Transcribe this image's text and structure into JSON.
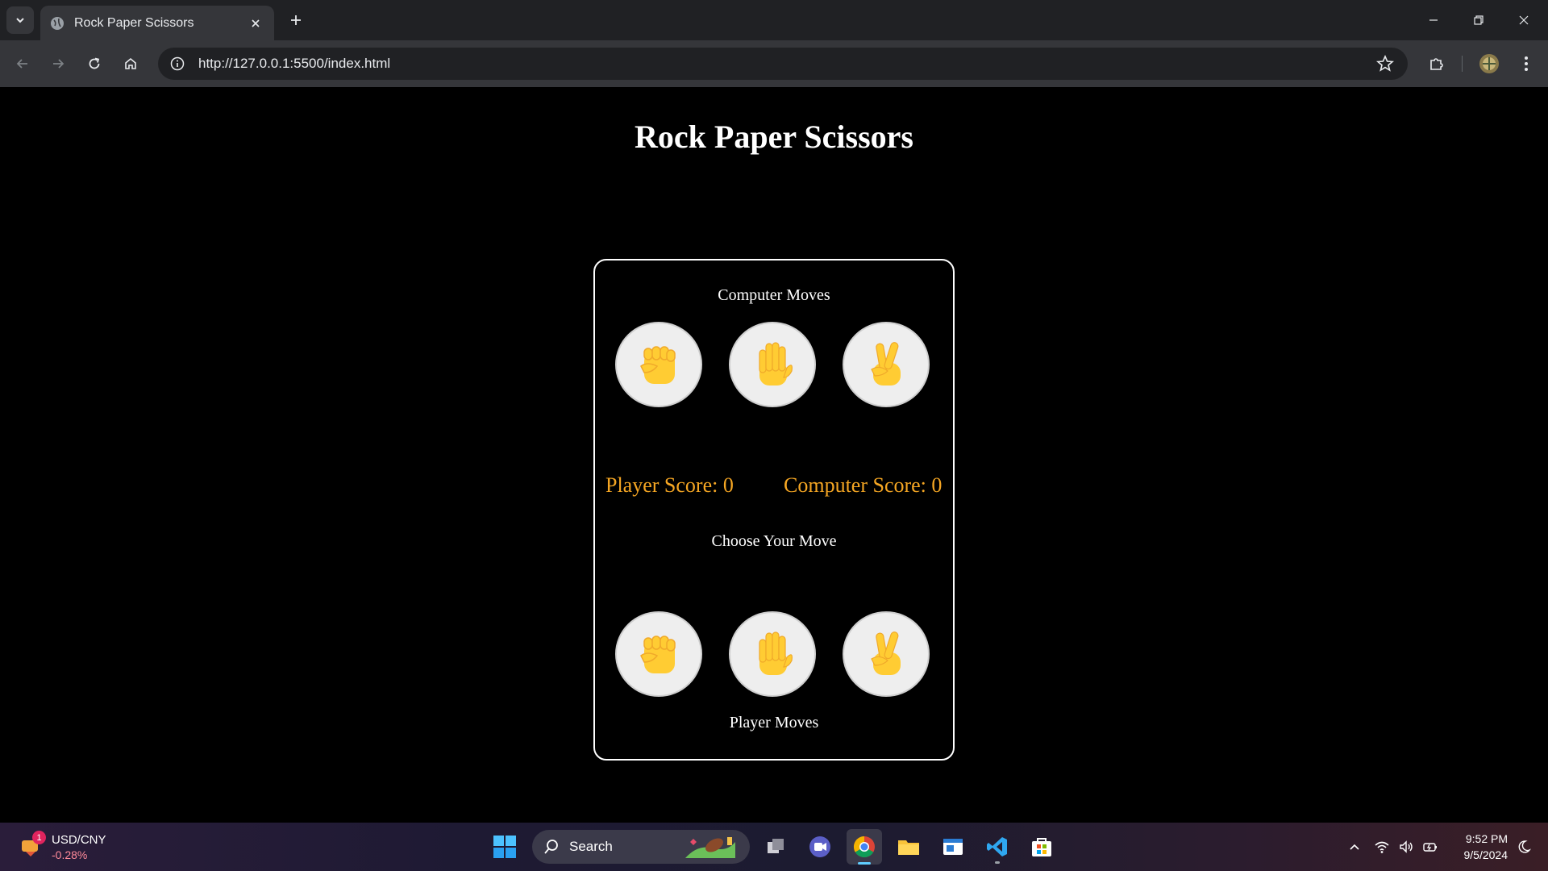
{
  "browser": {
    "tab_title": "Rock Paper Scissors",
    "url": "http://127.0.0.1:5500/index.html"
  },
  "page": {
    "title": "Rock Paper Scissors",
    "computer_label": "Computer Moves",
    "player_label": "Player Moves",
    "choose_label": "Choose Your Move",
    "player_score": "Player Score: 0",
    "computer_score": "Computer Score: 0",
    "score_color": "#f5a623",
    "moves": [
      "rock",
      "paper",
      "scissors"
    ]
  },
  "taskbar": {
    "widget_name": "USD/CNY",
    "widget_change": "-0.28%",
    "widget_badge": "1",
    "search_label": "Search",
    "time": "9:52 PM",
    "date": "9/5/2024"
  }
}
